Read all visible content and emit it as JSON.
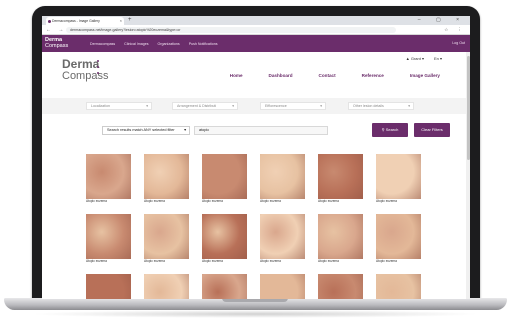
{
  "browser": {
    "tab_title": "Dermacompass - Image Gallery",
    "tab_close_icon": "×",
    "new_tab_icon": "+",
    "window_controls": "– ▢ ×",
    "nav_buttons": "← → ⟳ ⌂",
    "url": "dermacompass.net/image-gallery?lesion=atopic%20eczema&type=or",
    "extension_icons": "☆ ⋮"
  },
  "sitebar": {
    "logo_main": "Derma",
    "logo_sub": "Compass",
    "nav_items": [
      "Dermacompass",
      "Clinical Images",
      "Organizations",
      "Push Notifications"
    ],
    "logout": "Log Out"
  },
  "header": {
    "logo_main": "Derma",
    "logo_sub": "Compass",
    "user_name": "▲ Grant ▾",
    "lang": "En ▾",
    "nav": [
      "Home",
      "Dashboard",
      "Contact",
      "Reference",
      "Image Gallery"
    ]
  },
  "filters": [
    "Localization",
    "Arrangement & Distributi",
    "Efflorescence",
    "Other lesion details"
  ],
  "search": {
    "filter_mode": "Search results match ANY selected filter",
    "query": "atopic",
    "search_button": "Search",
    "clear_button": "Clear Filters"
  },
  "gallery": {
    "rows": [
      [
        "Atopic eczema",
        "Atopic eczema",
        "Atopic eczema",
        "Atopic eczema",
        "Atopic eczema",
        "Atopic eczema"
      ],
      [
        "Atopic eczema",
        "Atopic eczema",
        "Atopic eczema",
        "Atopic eczema",
        "Atopic eczema",
        "Atopic eczema"
      ],
      [
        "",
        "",
        "",
        "",
        "",
        ""
      ]
    ]
  },
  "colors": {
    "brand": "#6b2d6b",
    "skin_palette": [
      "#d9a78d",
      "#e3b898",
      "#c88a70",
      "#e7c2a2",
      "#b87058",
      "#f0d0b4"
    ]
  }
}
